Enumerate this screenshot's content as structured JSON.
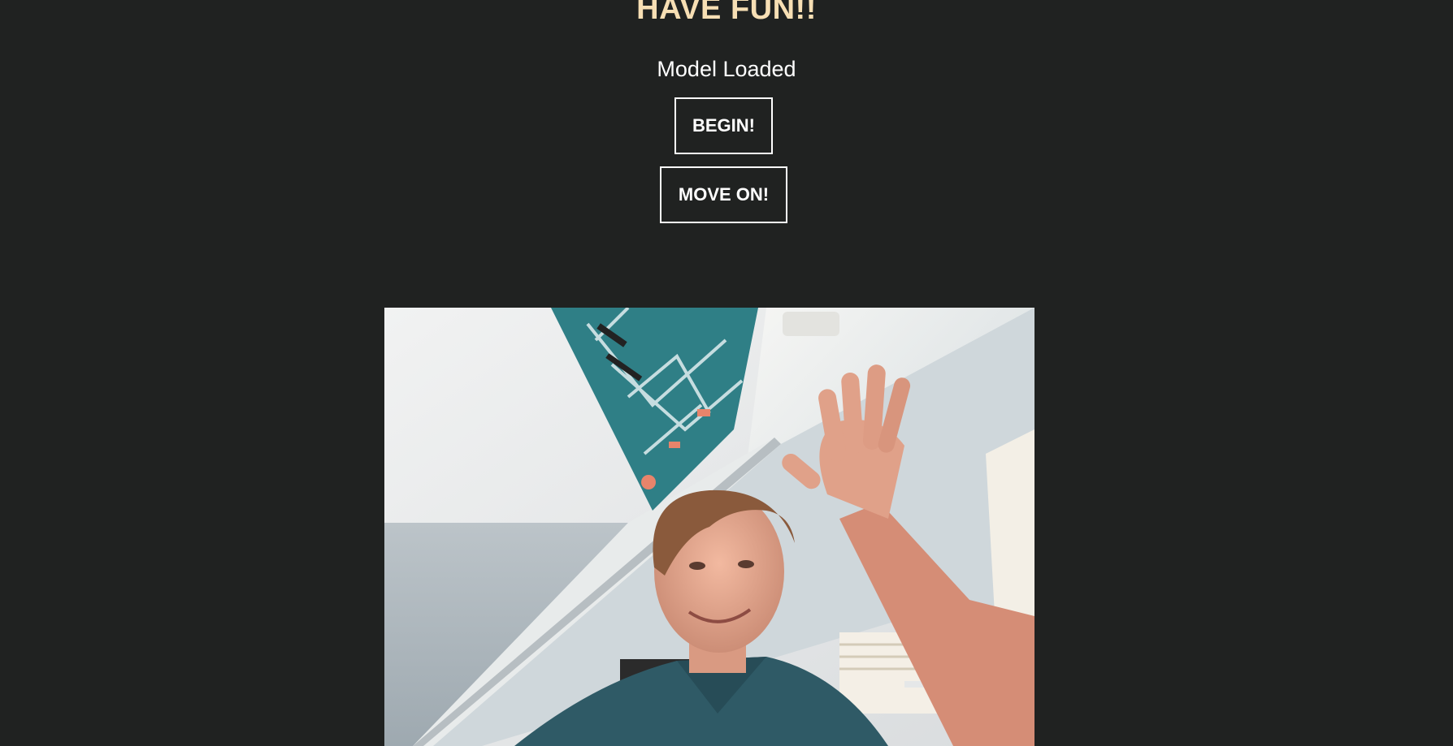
{
  "header": {
    "title": "HAVE FUN!!",
    "status": "Model Loaded"
  },
  "controls": {
    "begin_label": "BEGIN!",
    "move_on_label": "MOVE ON!"
  },
  "colors": {
    "background": "#202221",
    "title": "#f7dfb4",
    "text": "#ffffff"
  }
}
